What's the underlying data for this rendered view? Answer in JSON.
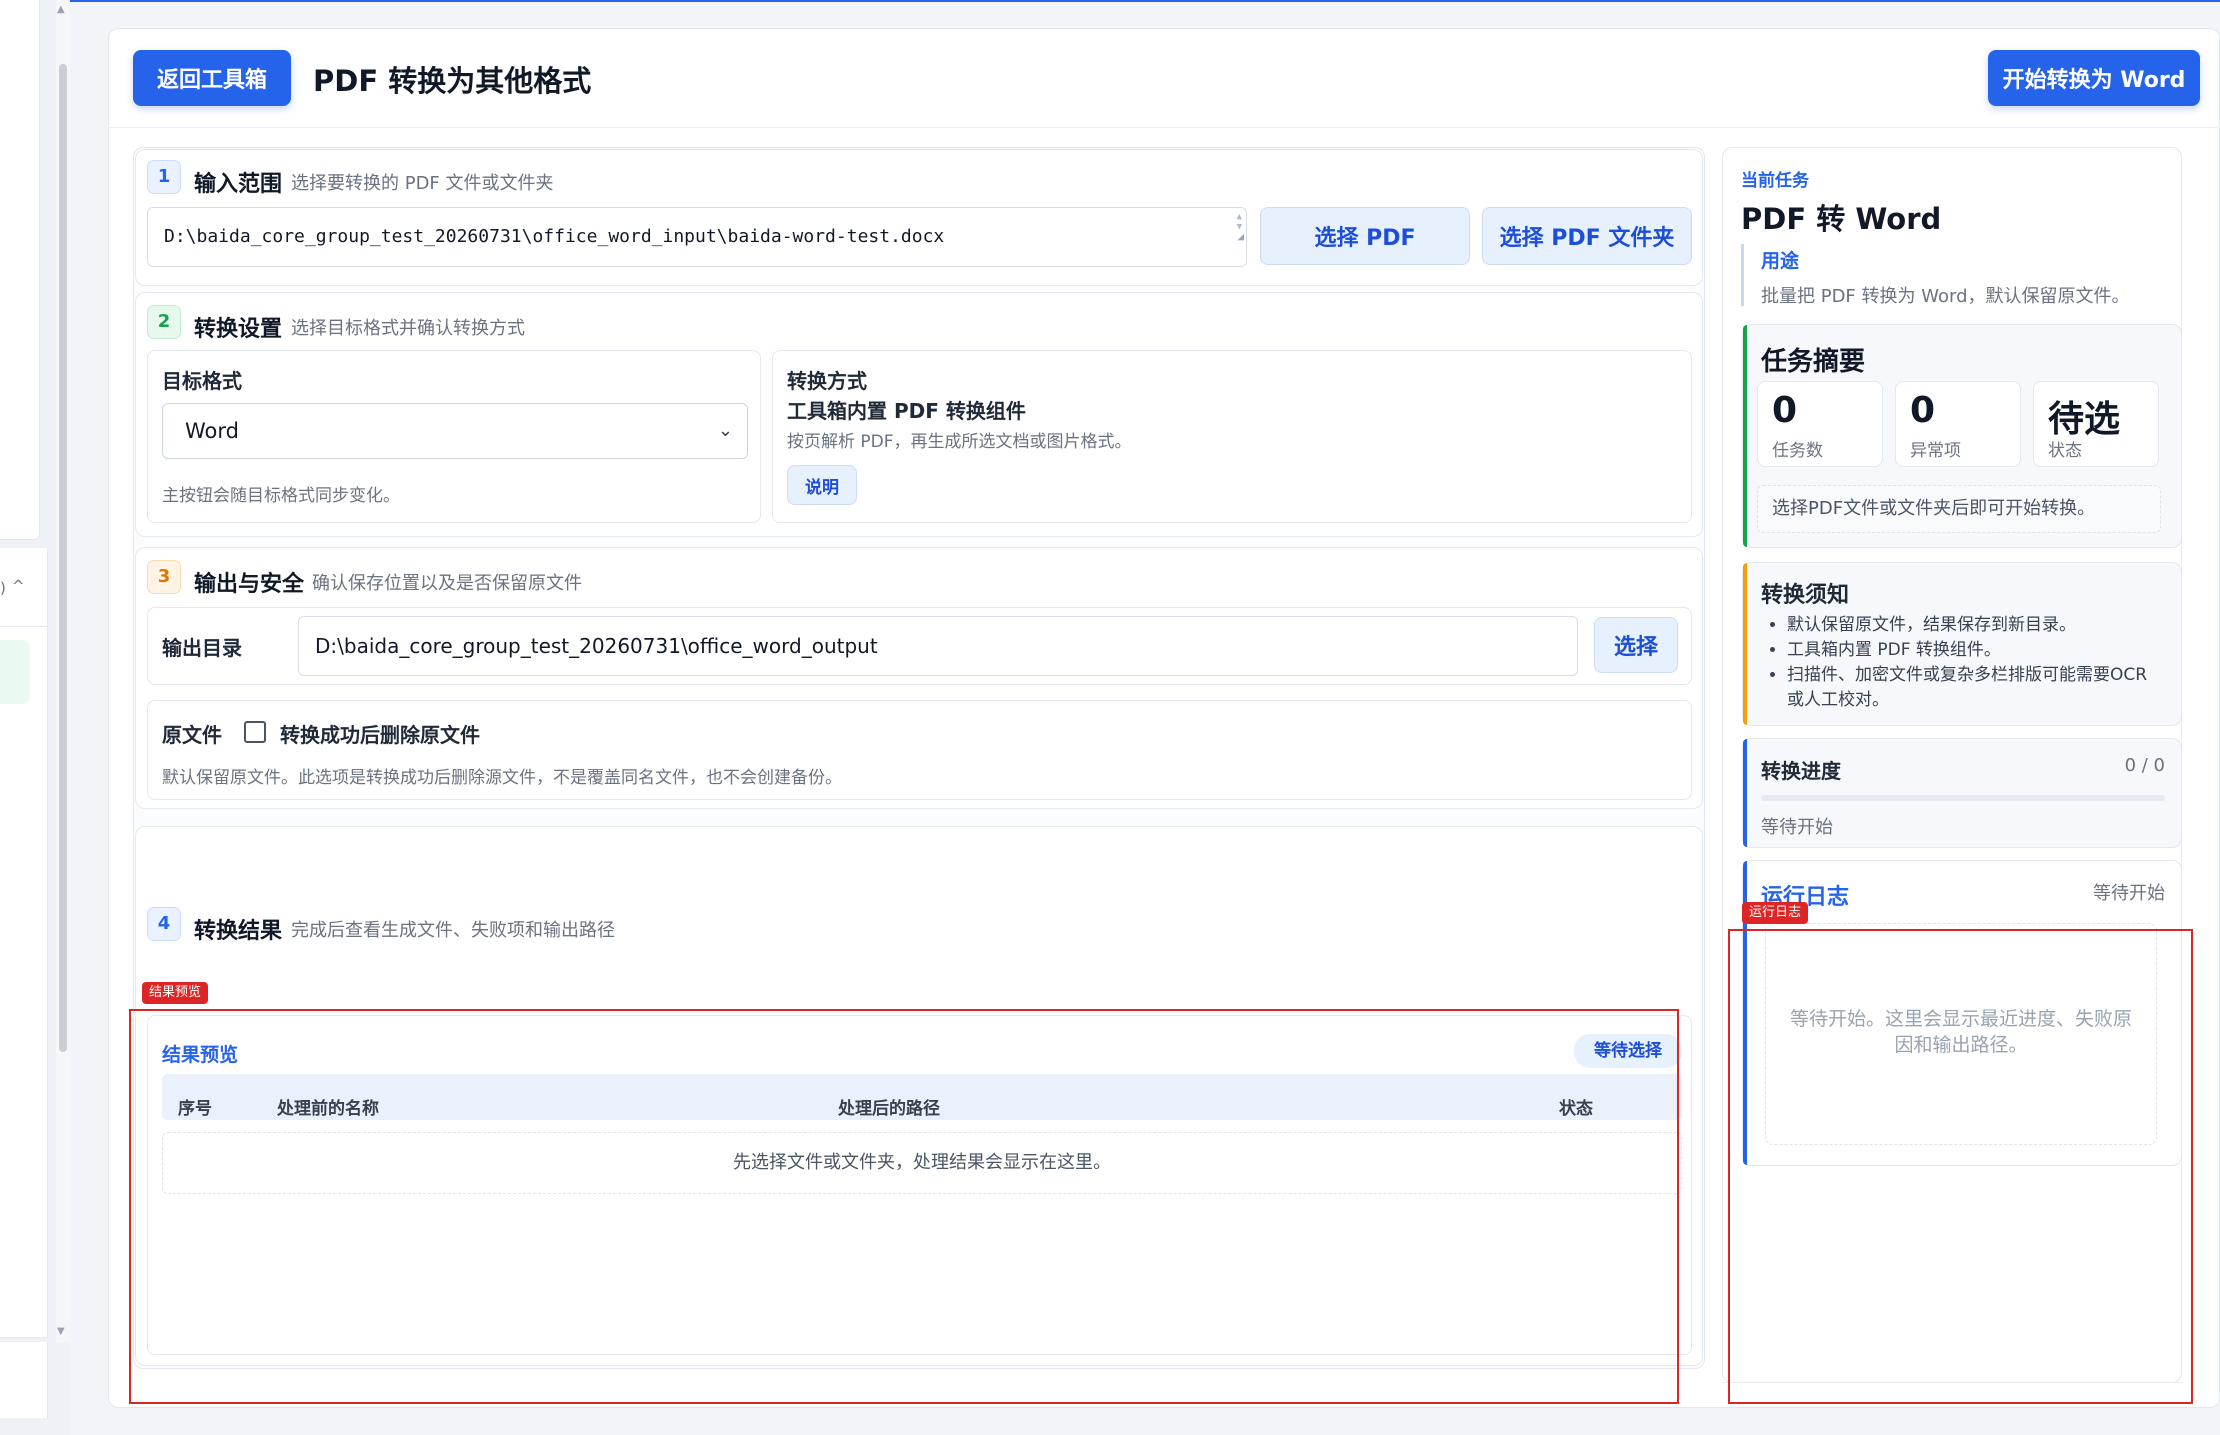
{
  "left_strip": {
    "paren": ")",
    "caret": "^",
    "scroll_up": "▲",
    "scroll_down": "▼"
  },
  "header": {
    "back_label": "返回工具箱",
    "title": "PDF 转换为其他格式",
    "start_label": "开始转换为 Word"
  },
  "section1": {
    "number": "1",
    "title": "输入范围",
    "subtitle": "选择要转换的 PDF 文件或文件夹",
    "input_value": "D:\\baida_core_group_test_20260731\\office_word_input\\baida-word-test.docx",
    "btn_pdf": "选择 PDF",
    "btn_folder": "选择 PDF 文件夹"
  },
  "section2": {
    "number": "2",
    "title": "转换设置",
    "subtitle": "选择目标格式并确认转换方式",
    "format_label": "目标格式",
    "format_value": "Word",
    "format_hint": "主按钮会随目标格式同步变化。",
    "method_label": "转换方式",
    "method_name": "工具箱内置 PDF 转换组件",
    "method_desc": "按页解析 PDF，再生成所选文档或图片格式。",
    "explain_btn": "说明"
  },
  "section3": {
    "number": "3",
    "title": "输出与安全",
    "subtitle": "确认保存位置以及是否保留原文件",
    "output_label": "输出目录",
    "output_value": "D:\\baida_core_group_test_20260731\\office_word_output",
    "choose_btn": "选择",
    "original_label": "原文件",
    "delete_checkbox_label": "转换成功后删除原文件",
    "delete_checked": false,
    "original_hint": "默认保留原文件。此选项是转换成功后删除源文件，不是覆盖同名文件，也不会创建备份。"
  },
  "section4": {
    "number": "4",
    "title": "转换结果",
    "subtitle": "完成后查看生成文件、失败项和输出路径",
    "tag": "结果预览",
    "preview_title": "结果预览",
    "status_pill": "等待选择",
    "columns": [
      "序号",
      "处理前的名称",
      "处理后的路径",
      "状态"
    ],
    "empty_text": "先选择文件或文件夹，处理结果会显示在这里。"
  },
  "right": {
    "caption": "当前任务",
    "task_title": "PDF 转 Word",
    "purpose_label": "用途",
    "purpose_text": "批量把 PDF 转换为 Word，默认保留原文件。",
    "summary_title": "任务摘要",
    "stats": [
      {
        "value": "0",
        "label": "任务数"
      },
      {
        "value": "0",
        "label": "异常项"
      },
      {
        "value": "待选",
        "label": "状态"
      }
    ],
    "summary_hint": "选择PDF文件或文件夹后即可开始转换。",
    "notes_title": "转换须知",
    "notes": [
      "默认保留原文件，结果保存到新目录。",
      "工具箱内置 PDF 转换组件。",
      "扫描件、加密文件或复杂多栏排版可能需要OCR 或人工校对。"
    ],
    "progress_title": "转换进度",
    "progress_count": "0 / 0",
    "progress_fraction": 0,
    "progress_status": "等待开始",
    "log_title": "运行日志",
    "log_status": "等待开始",
    "log_tag": "运行日志",
    "log_text": "等待开始。这里会显示最近进度、失败原因和输出路径。"
  },
  "colors": {
    "primary": "#2563eb",
    "accent_green": "#16a34a",
    "accent_orange": "#f59e0b",
    "annotation_red": "#dc2626"
  }
}
